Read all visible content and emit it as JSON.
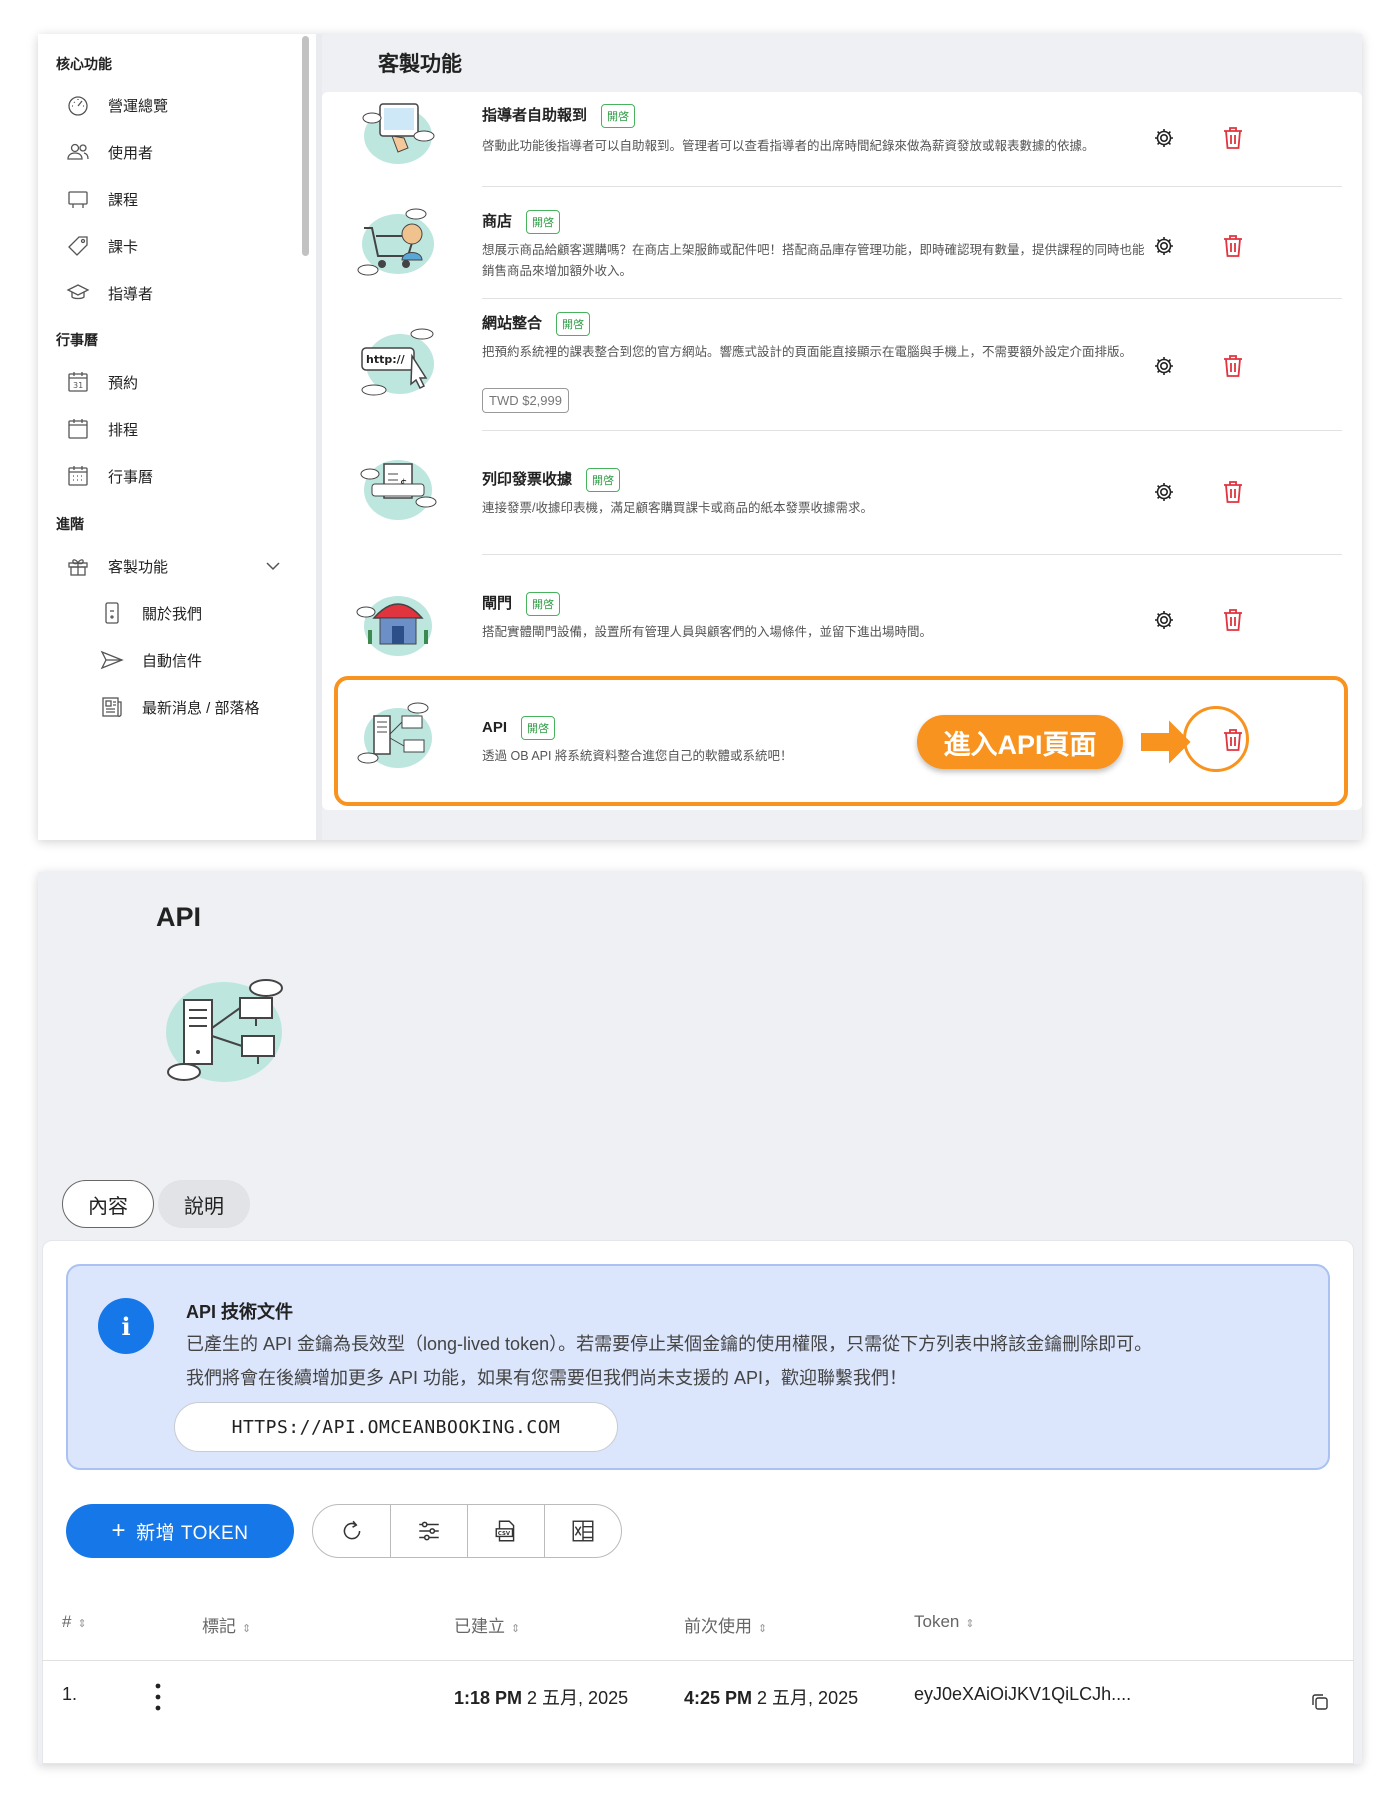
{
  "sidebar": {
    "sections": [
      {
        "label": "核心功能"
      },
      {
        "label": "行事曆"
      },
      {
        "label": "進階"
      }
    ],
    "items": [
      {
        "label": "營運總覽",
        "icon": "dashboard-icon"
      },
      {
        "label": "使用者",
        "icon": "users-icon"
      },
      {
        "label": "課程",
        "icon": "class-icon"
      },
      {
        "label": "課卡",
        "icon": "tag-icon"
      },
      {
        "label": "指導者",
        "icon": "graduation-icon"
      },
      {
        "label": "預約",
        "icon": "calendar-31-icon"
      },
      {
        "label": "排程",
        "icon": "calendar-icon"
      },
      {
        "label": "行事曆",
        "icon": "calendar-grid-icon"
      },
      {
        "label": "客製功能",
        "icon": "gift-icon"
      },
      {
        "label": "關於我們",
        "icon": "phone-icon"
      },
      {
        "label": "自動信件",
        "icon": "send-icon"
      },
      {
        "label": "最新消息 / 部落格",
        "icon": "newspaper-icon"
      }
    ]
  },
  "custom_features": {
    "page_title": "客製功能",
    "features": [
      {
        "name": "指導者自助報到",
        "badge": "開啓",
        "desc": "啓動此功能後指導者可以自助報到。管理者可以查看指導者的出席時間紀錄來做為薪資發放或報表數據的依據。"
      },
      {
        "name": "商店",
        "badge": "開啓",
        "desc": "想展示商品給顧客選購嗎？在商店上架服飾或配件吧！搭配商品庫存管理功能，即時確認現有數量，提供課程的同時也能銷售商品來增加額外收入。"
      },
      {
        "name": "網站整合",
        "badge": "開啓",
        "desc": "把預約系統裡的課表整合到您的官方網站。響應式設計的頁面能直接顯示在電腦與手機上，不需要額外設定介面排版。",
        "price": "TWD $2,999"
      },
      {
        "name": "列印發票收據",
        "badge": "開啓",
        "desc": "連接發票/收據印表機，滿足顧客購買課卡或商品的紙本發票收據需求。"
      },
      {
        "name": "閘門",
        "badge": "開啓",
        "desc": "搭配實體閘門設備，設置所有管理人員與顧客們的入場條件，並留下進出場時間。"
      },
      {
        "name": "API",
        "badge": "開啓",
        "desc": "透過 OB API 將系統資料整合進您自己的軟體或系統吧！"
      }
    ],
    "callout": "進入API頁面"
  },
  "api_page": {
    "title": "API",
    "tabs": [
      "內容",
      "說明"
    ],
    "info": {
      "title": "API 技術文件",
      "line1": "已產生的 API 金鑰為長效型（long-lived token）。若需要停止某個金鑰的使用權限，只需從下方列表中將該金鑰刪除即可。",
      "line2": "我們將會在後續增加更多 API 功能，如果有您需要但我們尚未支援的 API，歡迎聯繫我們！",
      "url": "HTTPS://API.OMCEANBOOKING.COM"
    },
    "add_button": "新增 TOKEN",
    "toolbar": [
      "refresh-icon",
      "filter-sliders-icon",
      "csv-export-icon",
      "excel-export-icon"
    ],
    "table": {
      "columns": [
        "#",
        "標記",
        "已建立",
        "前次使用",
        "Token"
      ],
      "rows": [
        {
          "index": "1.",
          "label": "",
          "created_time": "1:18 PM",
          "created_date": "2 五月, 2025",
          "last_used_time": "4:25 PM",
          "last_used_date": "2 五月, 2025",
          "token": "eyJ0eXAiOiJKV1QiLCJh...."
        }
      ]
    }
  },
  "colors": {
    "accent_blue": "#1677e8",
    "highlight_orange": "#f7931e",
    "badge_green": "#48b35d",
    "trash_red": "#e0343f"
  }
}
